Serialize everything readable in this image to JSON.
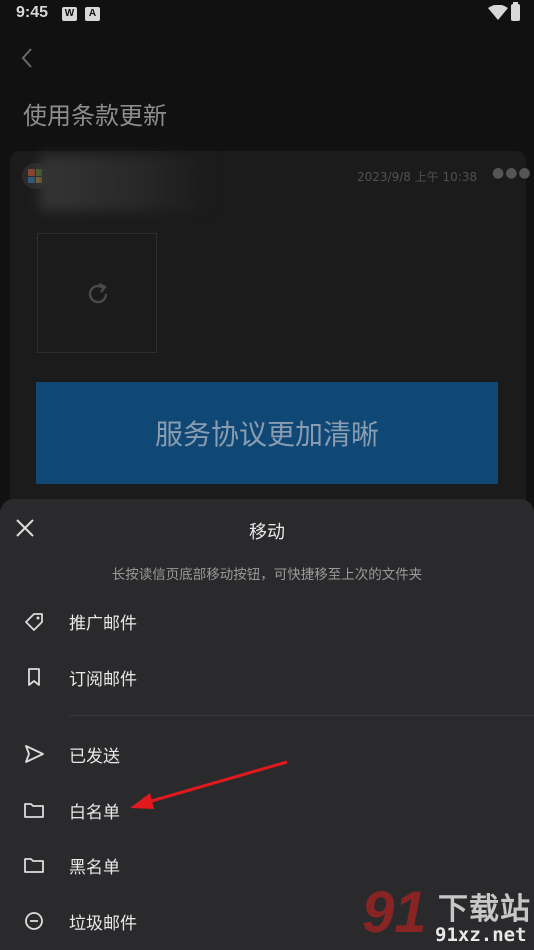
{
  "status_bar": {
    "time": "9:45",
    "app_icons": [
      "W",
      "A"
    ]
  },
  "page": {
    "title": "使用条款更新"
  },
  "mail": {
    "date": "2023/9/8 上午 10:38",
    "banner_text": "服务协议更加清晰",
    "banner_color": "#0f4775"
  },
  "sheet": {
    "title": "移动",
    "hint": "长按读信页底部移动按钮，可快捷移至上次的文件夹",
    "items": [
      {
        "label": "推广邮件",
        "icon": "tag-icon"
      },
      {
        "label": "订阅邮件",
        "icon": "bookmark-icon"
      },
      {
        "label": "已发送",
        "icon": "send-icon"
      },
      {
        "label": "白名单",
        "icon": "folder-icon"
      },
      {
        "label": "黑名单",
        "icon": "folder-icon"
      },
      {
        "label": "垃圾邮件",
        "icon": "block-icon"
      }
    ]
  },
  "annotation": {
    "arrow_color": "#e0191e"
  },
  "watermark": {
    "logo": "91",
    "name": "下载站",
    "url": "91xz.net"
  }
}
